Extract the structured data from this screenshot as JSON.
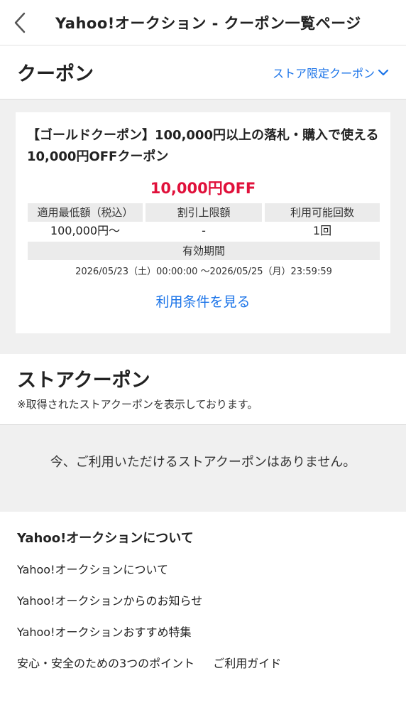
{
  "header": {
    "title": "Yahoo!オークション - クーポン一覧ページ"
  },
  "coupon_section": {
    "title": "クーポン",
    "filter_label": "ストア限定クーポン"
  },
  "coupon": {
    "name": "【ゴールドクーポン】100,000円以上の落札・購入で使える10,000円OFFクーポン",
    "discount": "10,000円OFF",
    "min_amount_label": "適用最低額（税込）",
    "min_amount_value": "100,000円〜",
    "max_discount_label": "割引上限額",
    "max_discount_value": "-",
    "uses_label": "利用可能回数",
    "uses_value": "1回",
    "period_label": "有効期間",
    "period_value": "2026/05/23（土）00:00:00 〜2026/05/25（月）23:59:59",
    "terms_link": "利用条件を見る",
    "discount_color": "#e0113b"
  },
  "store_section": {
    "title": "ストアクーポン",
    "note": "※取得されたストアクーポンを表示しております。",
    "empty_message": "今、ご利用いただけるストアクーポンはありません。"
  },
  "footer": {
    "title": "Yahoo!オークションについて",
    "links": [
      "Yahoo!オークションについて",
      "Yahoo!オークションからのお知らせ",
      "Yahoo!オークションおすすめ特集",
      "安心・安全のための3つのポイント",
      "ご利用ガイド"
    ]
  },
  "colors": {
    "link": "#1a73e8",
    "accent_red": "#e0113b",
    "gray_bg": "#f0f0f0"
  }
}
